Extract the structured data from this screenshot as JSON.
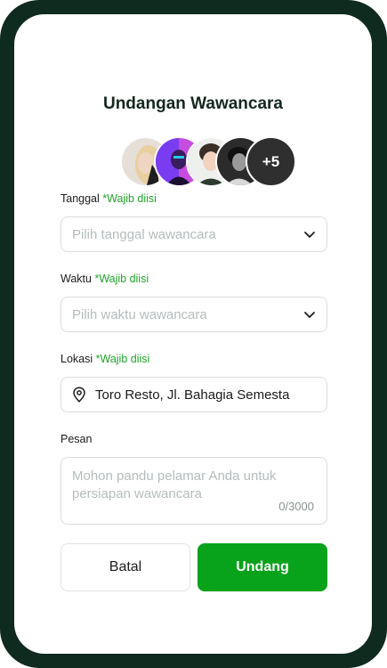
{
  "title": "Undangan Wawancara",
  "avatars": {
    "icons": [
      "avatar-1",
      "avatar-2",
      "avatar-3",
      "avatar-4"
    ],
    "more_count": "+5"
  },
  "form": {
    "date": {
      "label": "Tanggal",
      "required": "*Wajib diisi",
      "placeholder": "Pilih tanggal wawancara"
    },
    "time": {
      "label": "Waktu",
      "required": "*Wajib diisi",
      "placeholder": "Pilih waktu wawancara"
    },
    "location": {
      "label": "Lokasi",
      "required": "*Wajib diisi",
      "value": "Toro Resto, Jl. Bahagia Semesta"
    },
    "message": {
      "label": "Pesan",
      "placeholder": "Mohon pandu pelamar Anda untuk persiapan wawancara",
      "counter": "0/3000"
    }
  },
  "buttons": {
    "cancel": "Batal",
    "invite": "Undang"
  },
  "colors": {
    "frame": "#0f2a1f",
    "accent": "#08a21b",
    "required": "#20a52a"
  }
}
